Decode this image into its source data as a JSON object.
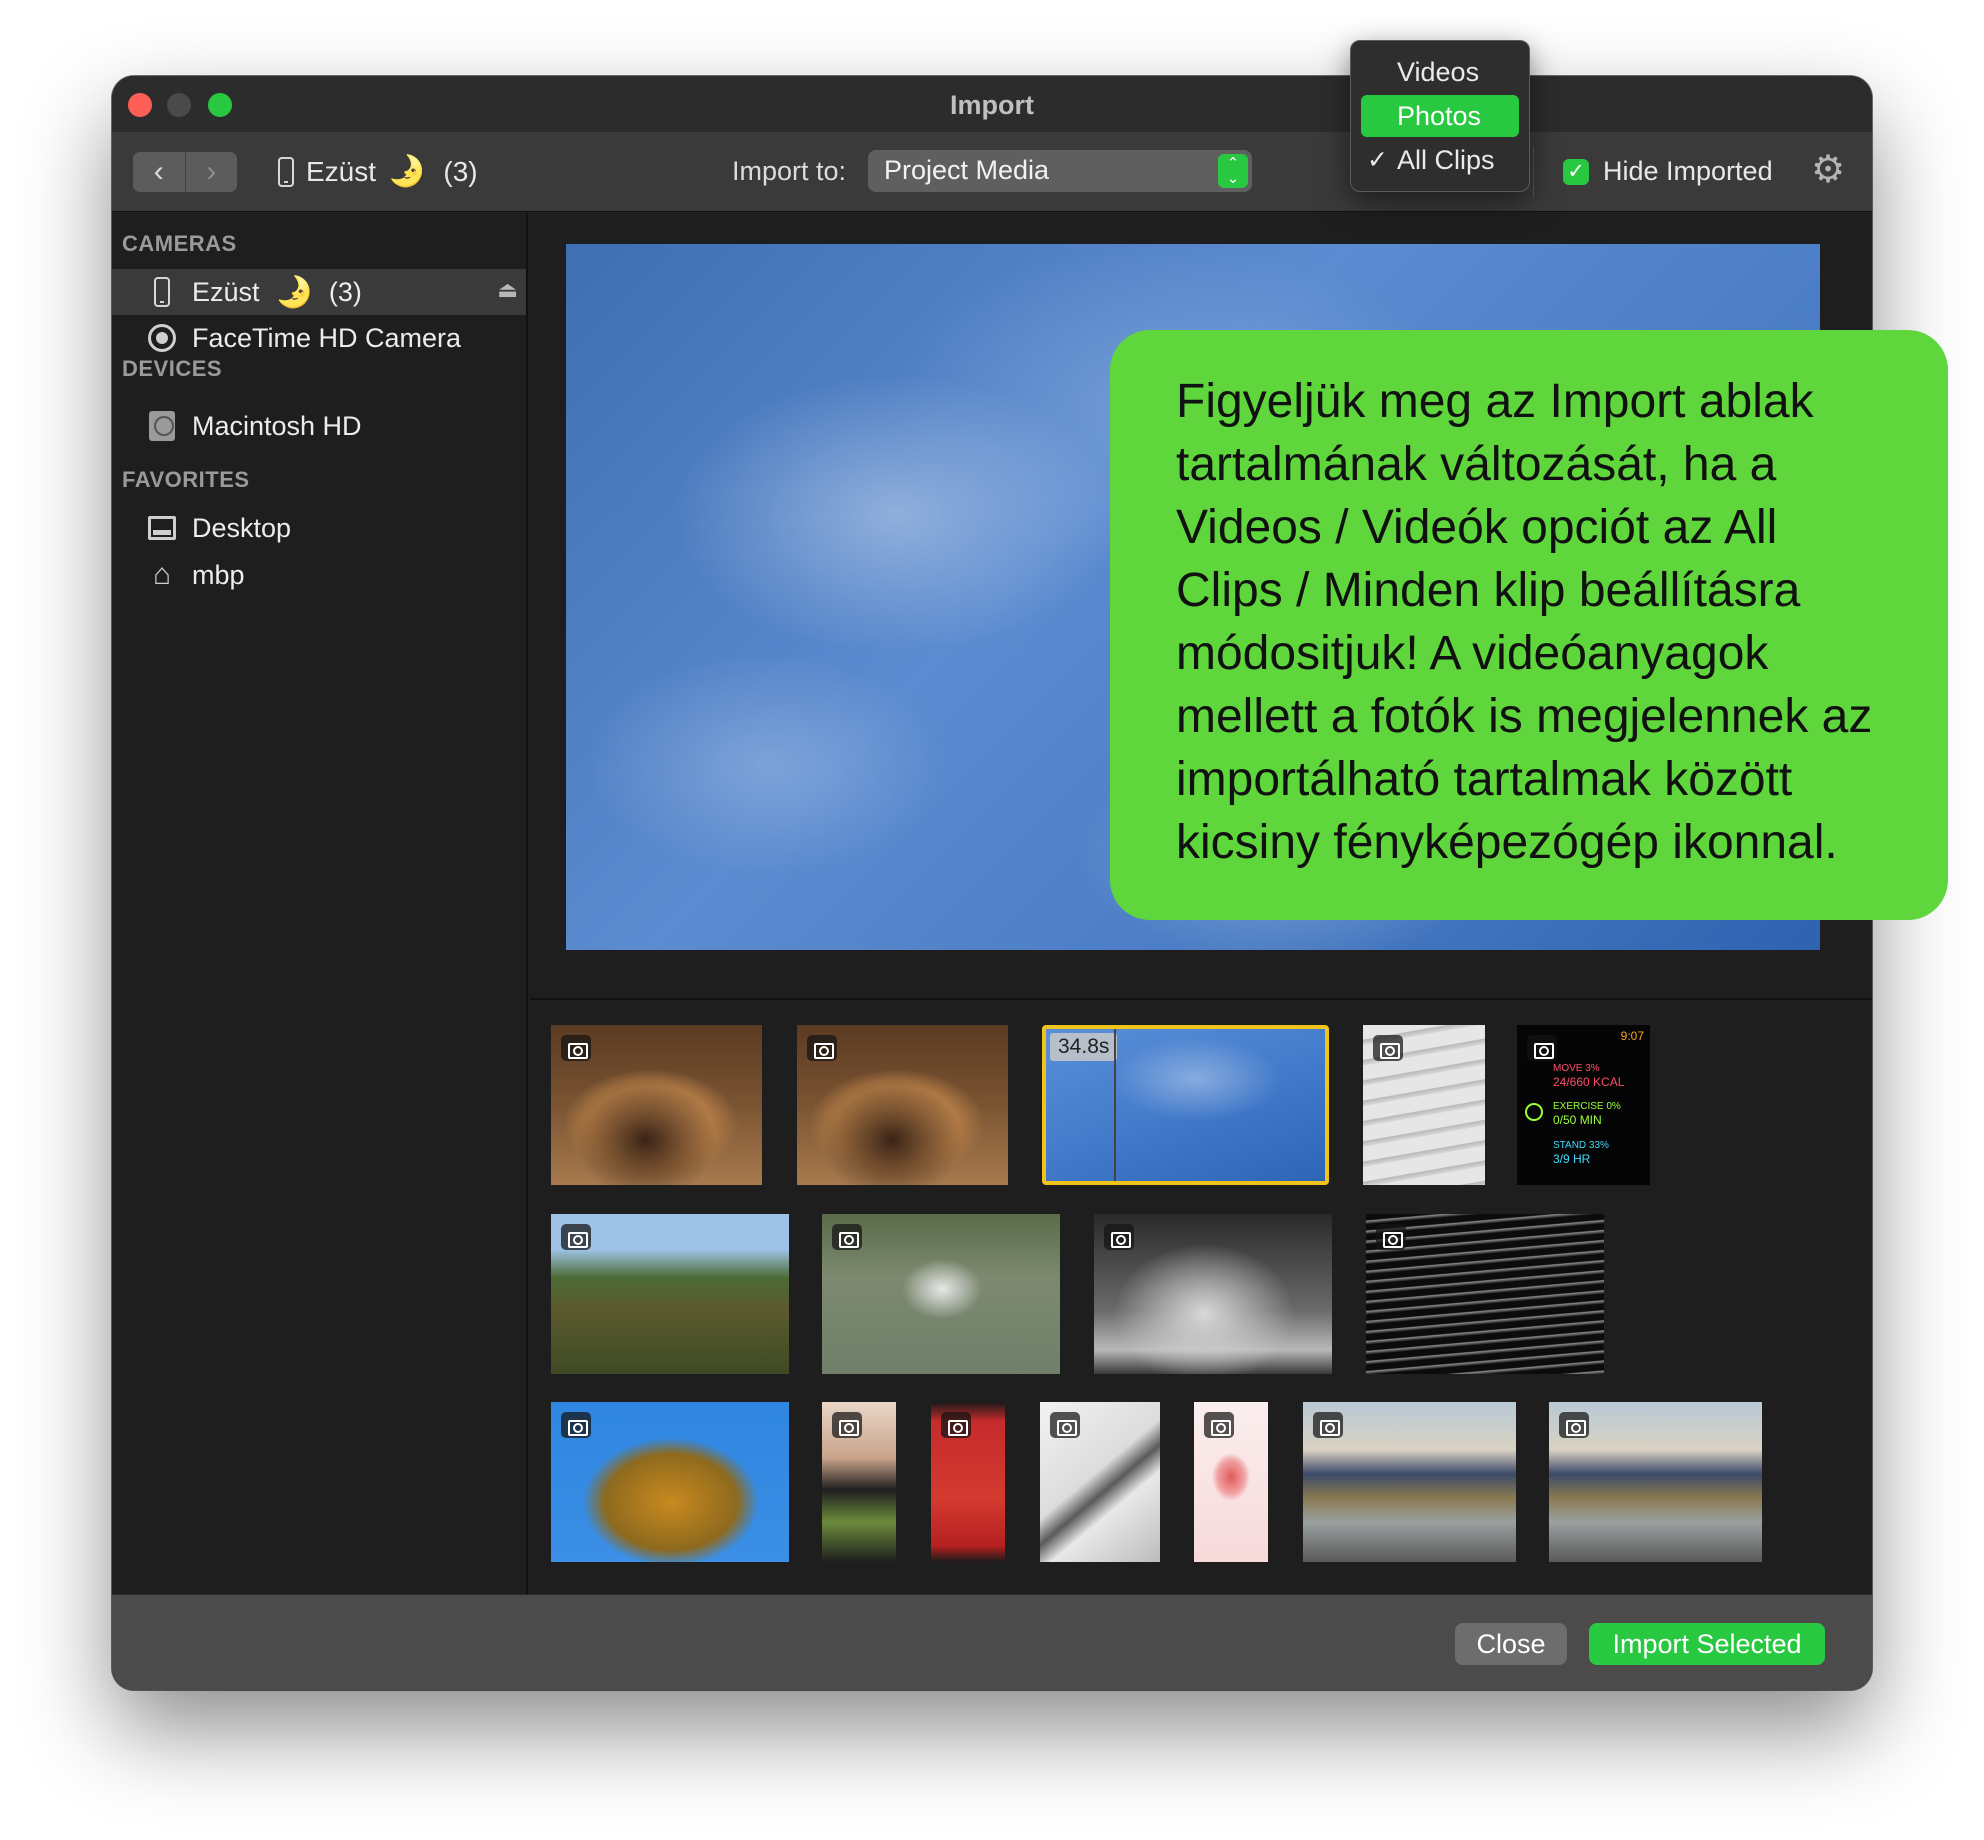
{
  "window": {
    "title": "Import"
  },
  "toolbar": {
    "back_icon": "chevron-left-icon",
    "forward_icon": "chevron-right-icon",
    "back_glyph": "‹",
    "forward_glyph": "›",
    "device_name": "Ezüst",
    "device_emoji": "🌛",
    "device_count": "(3)",
    "import_to_label": "Import to:",
    "import_to_value": "Project Media",
    "hide_imported_label": "Hide Imported",
    "hide_imported_checked": true,
    "settings_icon": "gear-icon"
  },
  "filter_menu": {
    "items": [
      {
        "label": "Videos",
        "highlighted": false,
        "checked": false
      },
      {
        "label": "Photos",
        "highlighted": true,
        "checked": false
      },
      {
        "label": "All Clips",
        "highlighted": false,
        "checked": true
      }
    ],
    "check_glyph": "✓"
  },
  "sidebar": {
    "sections": [
      {
        "title": "CAMERAS"
      },
      {
        "title": "DEVICES"
      },
      {
        "title": "FAVORITES"
      }
    ],
    "items": [
      {
        "label": "Ezüst",
        "emoji": "🌛",
        "count": "(3)",
        "icon": "iphone-icon",
        "selected": true
      },
      {
        "label": "FaceTime HD Camera",
        "icon": "camera-icon"
      },
      {
        "label": "Macintosh HD",
        "icon": "hard-drive-icon"
      },
      {
        "label": "Desktop",
        "icon": "desktop-folder-icon"
      },
      {
        "label": "mbp",
        "icon": "home-icon"
      }
    ]
  },
  "thumbnails": [
    {
      "kind": "photo",
      "subject": "dog lying down"
    },
    {
      "kind": "photo",
      "subject": "dog lying down"
    },
    {
      "kind": "video",
      "subject": "blue sky",
      "duration": "34.8s",
      "selected": true
    },
    {
      "kind": "photo",
      "subject": "paper labels in hand"
    },
    {
      "kind": "photo",
      "subject": "activity screenshot",
      "activity": {
        "time": "9:07",
        "move": "MOVE 3%",
        "move_val": "24/660 KCAL",
        "exercise": "EXERCISE 0%",
        "exercise_val": "0/50 MIN",
        "stand": "STAND 33%",
        "stand_val": "3/9 HR"
      }
    },
    {
      "kind": "photo",
      "subject": "hill with castle"
    },
    {
      "kind": "photo",
      "subject": "heron over water"
    },
    {
      "kind": "photo",
      "subject": "misty bridge"
    },
    {
      "kind": "photo",
      "subject": "dark sparkling water"
    },
    {
      "kind": "photo",
      "subject": "autumn tree"
    },
    {
      "kind": "photo",
      "subject": "phone screenshot"
    },
    {
      "kind": "photo",
      "subject": "red phone screenshot"
    },
    {
      "kind": "photo",
      "subject": "boxes"
    },
    {
      "kind": "photo",
      "subject": "hand icon screenshot"
    },
    {
      "kind": "photo",
      "subject": "train at station"
    },
    {
      "kind": "photo",
      "subject": "train at station"
    }
  ],
  "buttons": {
    "close": "Close",
    "import_selected": "Import Selected"
  },
  "callout": {
    "lines": [
      "Figyeljük meg az Import ablak",
      "tartalmának változását, ha a",
      "Videos / Videók opciót az All",
      "Clips / Minden klip beállításra",
      "módositjuk! A videóanyagok",
      "mellett a fotók is megjelennek az",
      "importálható tartalmak között",
      "kicsiny fényképezógép ikonnal."
    ],
    "color": "#5ed63c"
  },
  "colors": {
    "accent_green": "#28c840",
    "close_red": "#ff5f57",
    "selection_yellow": "#f0c419"
  }
}
